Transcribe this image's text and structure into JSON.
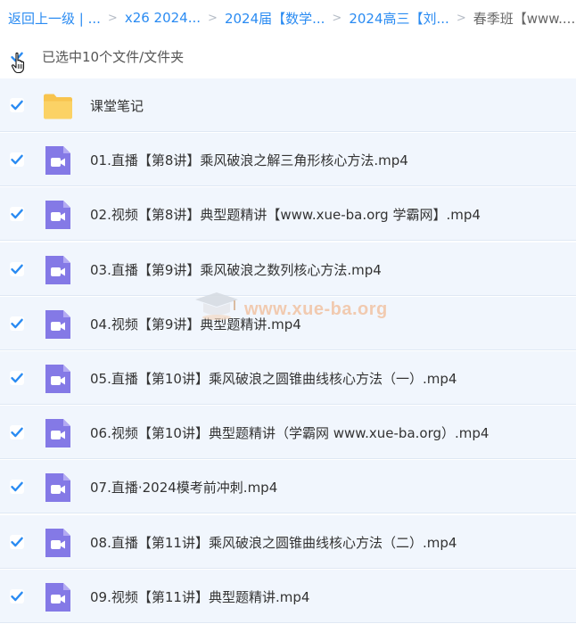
{
  "breadcrumb": {
    "items": [
      "返回上一级 | ...",
      "x26 2024...",
      "2024届【数学...",
      "2024高三【刘...",
      "春季班【www...."
    ]
  },
  "selection": {
    "checked": true,
    "status_text": "已选中10个文件/文件夹"
  },
  "files": [
    {
      "name": "课堂笔记",
      "type": "folder",
      "checked": true
    },
    {
      "name": "01.直播【第8讲】乘风破浪之解三角形核心方法.mp4",
      "type": "video",
      "checked": true
    },
    {
      "name": "02.视频【第8讲】典型题精讲【www.xue-ba.org 学霸网】.mp4",
      "type": "video",
      "checked": true
    },
    {
      "name": "03.直播【第9讲】乘风破浪之数列核心方法.mp4",
      "type": "video",
      "checked": true
    },
    {
      "name": "04.视频【第9讲】典型题精讲.mp4",
      "type": "video",
      "checked": true
    },
    {
      "name": "05.直播【第10讲】乘风破浪之圆锥曲线核心方法（一）.mp4",
      "type": "video",
      "checked": true
    },
    {
      "name": "06.视频【第10讲】典型题精讲（学霸网 www.xue-ba.org）.mp4",
      "type": "video",
      "checked": true
    },
    {
      "name": "07.直播·2024模考前冲刺.mp4",
      "type": "video",
      "checked": true
    },
    {
      "name": "08.直播【第11讲】乘风破浪之圆锥曲线核心方法（二）.mp4",
      "type": "video",
      "checked": true
    },
    {
      "name": "09.视频【第11讲】典型题精讲.mp4",
      "type": "video",
      "checked": true
    }
  ],
  "watermark": {
    "text": "www.xue-ba.org"
  },
  "colors": {
    "accent": "#2a8bf2",
    "row_background": "#f1f6fd",
    "folder": "#f8c44e",
    "video": "#8479e6"
  }
}
